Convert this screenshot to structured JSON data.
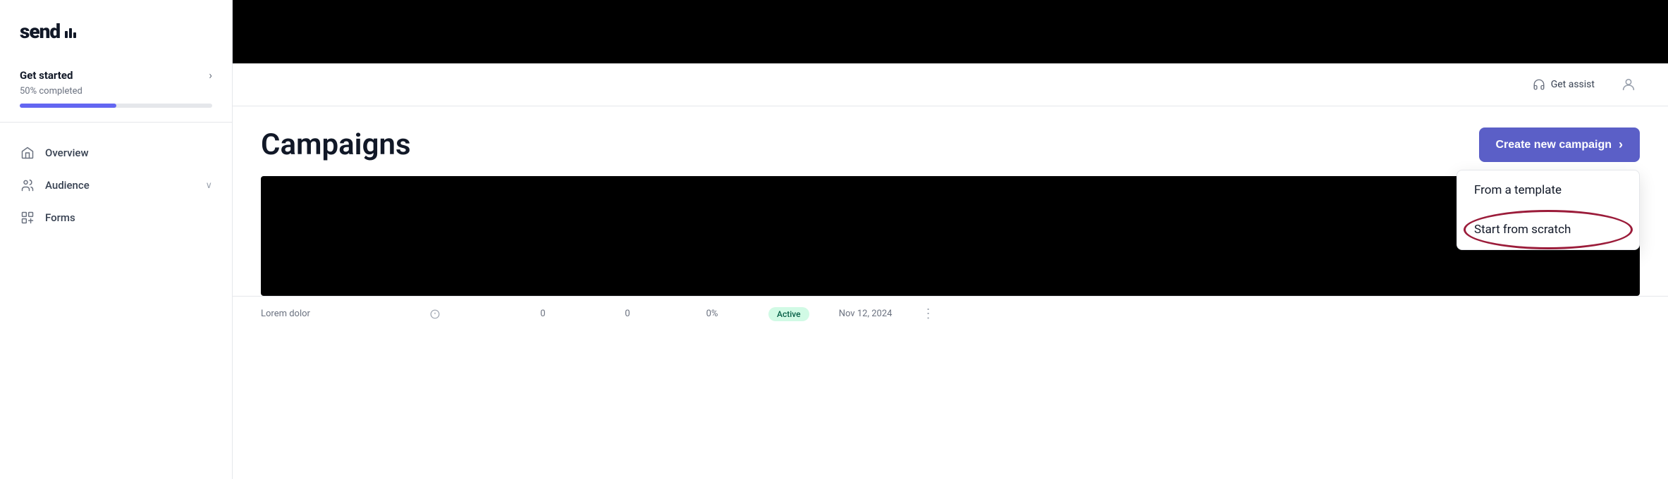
{
  "sidebar": {
    "logo": {
      "text": "send",
      "bars_label": "logo-bars"
    },
    "get_started": {
      "title": "Get started",
      "subtitle": "50% completed",
      "progress_percent": 50,
      "chevron": "›"
    },
    "nav_items": [
      {
        "id": "overview",
        "label": "Overview",
        "icon": "home-icon"
      },
      {
        "id": "audience",
        "label": "Audience",
        "icon": "audience-icon",
        "has_chevron": true
      },
      {
        "id": "forms",
        "label": "Forms",
        "icon": "forms-icon"
      }
    ]
  },
  "header": {
    "get_assist_label": "Get assist",
    "user_icon": "user-icon"
  },
  "main": {
    "page_title": "Campaigns",
    "create_button_label": "Create new campaign",
    "create_button_chevron": "›"
  },
  "dropdown": {
    "items": [
      {
        "id": "from-template",
        "label": "From a template"
      },
      {
        "id": "start-scratch",
        "label": "Start from scratch"
      }
    ]
  },
  "table": {
    "row": {
      "name": "Lorem dolor",
      "col2": "0",
      "col3": "0",
      "col4": "0%",
      "status": "Active",
      "date": "Nov 12, 2024"
    }
  },
  "colors": {
    "accent": "#5b5fc7",
    "progress": "#6366f1",
    "circle_annotation": "#9b1c3a"
  }
}
